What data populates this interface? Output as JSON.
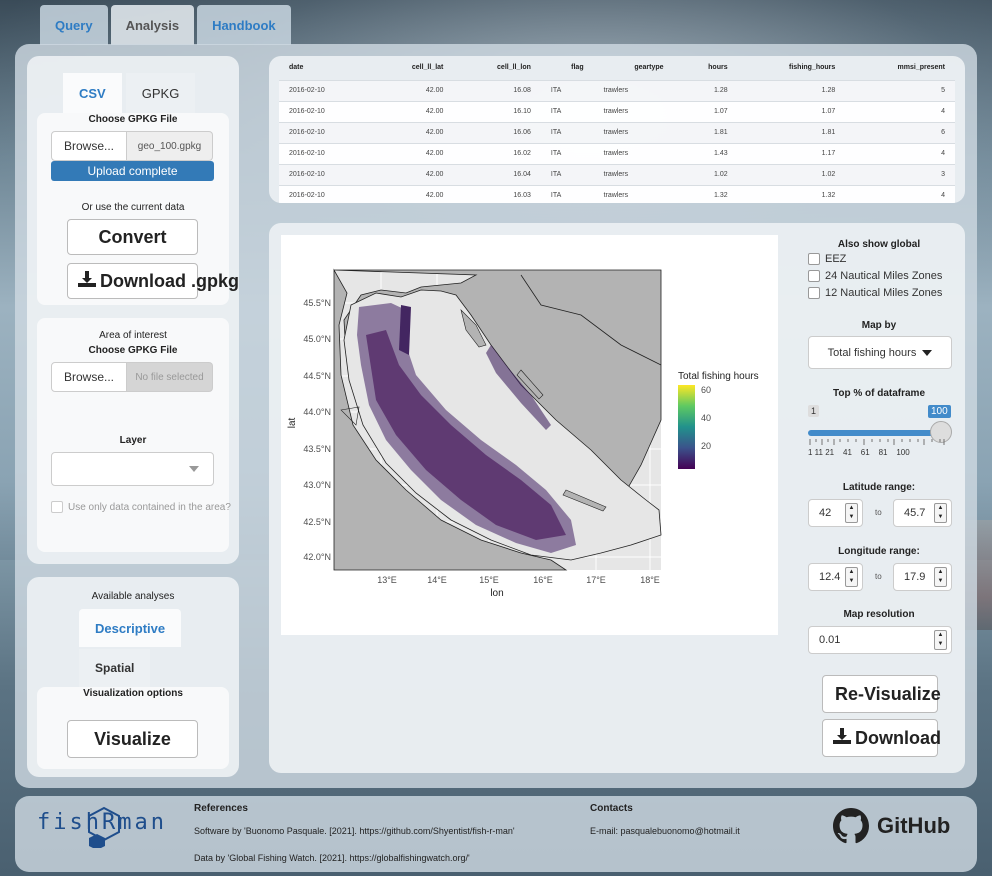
{
  "tabs": [
    "Query",
    "Analysis",
    "Handbook"
  ],
  "left": {
    "subtabs": [
      "CSV",
      "GPKG"
    ],
    "choose_label": "Choose GPKG File",
    "browse_label": "Browse...",
    "file_name": "geo_100.gpkg",
    "upload_status": "Upload complete",
    "or_use_label": "Or use the current data",
    "convert_label": "Convert",
    "download_label": "Download .gpkg",
    "aoi_label": "Area of interest",
    "aoi_choose_label": "Choose GPKG File",
    "aoi_browse_label": "Browse...",
    "aoi_file_placeholder": "No file selected",
    "layer_label": "Layer",
    "only_area_label": "Use only data contained in the area?"
  },
  "analyses": {
    "title": "Available analyses",
    "tabs": [
      "Descriptive",
      "Spatial"
    ],
    "viz_options_label": "Visualization options",
    "visualize_label": "Visualize"
  },
  "table": {
    "columns": [
      "date",
      "cell_ll_lat",
      "cell_ll_lon",
      "flag",
      "geartype",
      "hours",
      "fishing_hours",
      "mmsi_present"
    ],
    "rows": [
      [
        "2016-02-10",
        "42.00",
        "16.08",
        "ITA",
        "trawlers",
        "1.28",
        "1.28",
        "5"
      ],
      [
        "2016-02-10",
        "42.00",
        "16.10",
        "ITA",
        "trawlers",
        "1.07",
        "1.07",
        "4"
      ],
      [
        "2016-02-10",
        "42.00",
        "16.06",
        "ITA",
        "trawlers",
        "1.81",
        "1.81",
        "6"
      ],
      [
        "2016-02-10",
        "42.00",
        "16.02",
        "ITA",
        "trawlers",
        "1.43",
        "1.17",
        "4"
      ],
      [
        "2016-02-10",
        "42.00",
        "16.04",
        "ITA",
        "trawlers",
        "1.02",
        "1.02",
        "3"
      ],
      [
        "2016-02-10",
        "42.00",
        "16.03",
        "ITA",
        "trawlers",
        "1.32",
        "1.32",
        "4"
      ]
    ]
  },
  "map": {
    "xlabel": "lon",
    "ylabel": "lat",
    "xticks": [
      "13°E",
      "14°E",
      "15°E",
      "16°E",
      "17°E",
      "18°E"
    ],
    "yticks": [
      "42.0°N",
      "42.5°N",
      "43.0°N",
      "43.5°N",
      "44.0°N",
      "44.5°N",
      "45.0°N",
      "45.5°N"
    ],
    "legend_title": "Total fishing hours",
    "legend_ticks": [
      "60",
      "40",
      "20"
    ]
  },
  "controls": {
    "also_show_label": "Also show global",
    "overlays": [
      "EEZ",
      "24 Nautical Miles Zones",
      "12 Nautical Miles Zones"
    ],
    "map_by_label": "Map by",
    "map_by_value": "Total fishing hours",
    "top_pct_label": "Top % of dataframe",
    "slider_min": "1",
    "slider_max": "100",
    "slider_ticks": [
      "1",
      "11",
      "21",
      "41",
      "61",
      "81",
      "100"
    ],
    "slider_ticks_labels": "1 11 21    41    61    81    100",
    "lat_label": "Latitude range:",
    "lat_from": "42",
    "lat_to": "45.7",
    "lon_label": "Longitude range:",
    "lon_from": "12.4",
    "lon_to": "17.9",
    "to_label": "to",
    "resolution_label": "Map resolution",
    "resolution_value": "0.01",
    "revisualize_label": "Re-Visualize",
    "download_label": "Download"
  },
  "footer": {
    "logo_text": "fishRman",
    "references_title": "References",
    "ref1": "Software by 'Buonomo Pasquale. [2021]. https://github.com/Shyentist/fish-r-man'",
    "ref2": "Data by 'Global Fishing Watch. [2021]. https://globalfishingwatch.org/'",
    "contacts_title": "Contacts",
    "email": "E-mail: pasqualebuonomo@hotmail.it",
    "github_label": "GitHub"
  }
}
